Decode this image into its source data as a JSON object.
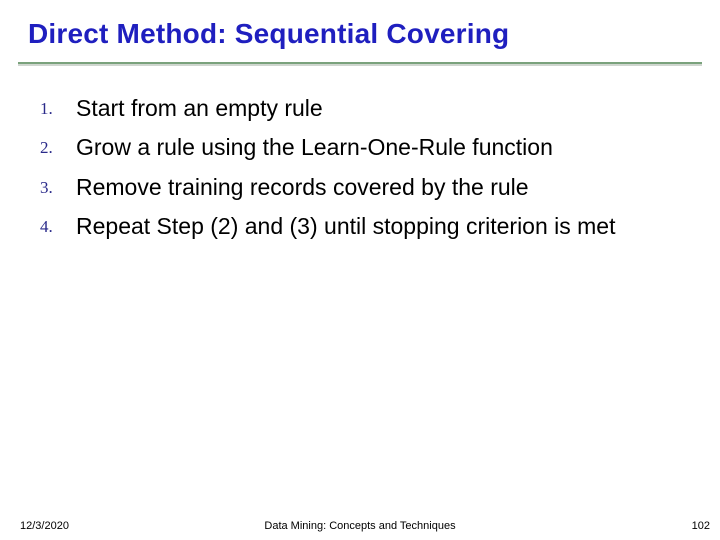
{
  "title": "Direct Method: Sequential Covering",
  "list": {
    "items": [
      {
        "num": "1.",
        "text": "Start from an empty rule"
      },
      {
        "num": "2.",
        "text": "Grow a rule using the Learn-One-Rule function"
      },
      {
        "num": "3.",
        "text": "Remove training records covered by the rule"
      },
      {
        "num": "4.",
        "text": "Repeat Step (2) and (3) until stopping criterion is met"
      }
    ]
  },
  "footer": {
    "date": "12/3/2020",
    "center": "Data Mining: Concepts and Techniques",
    "page": "102"
  }
}
